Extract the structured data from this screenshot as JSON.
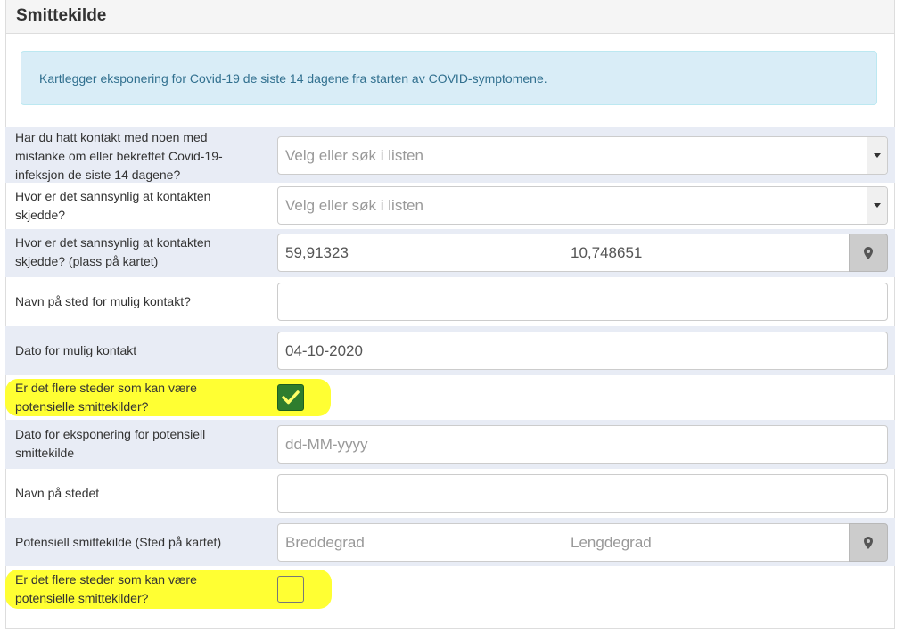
{
  "section": {
    "title": "Smittekilde",
    "info": "Kartlegger eksponering for Covid-19 de siste 14 dagene fra starten av COVID-symptomene."
  },
  "fields": {
    "contact_known": {
      "label_lines": [
        "Har du hatt kontakt med noen med",
        "mistanke om eller bekreftet Covid-19-",
        "infeksjon de siste 14 dagene?"
      ],
      "placeholder": "Velg eller søk i listen"
    },
    "contact_where": {
      "label_lines": [
        "Hvor er det sannsynlig at kontakten",
        "skjedde?"
      ],
      "placeholder": "Velg eller søk i listen"
    },
    "contact_map": {
      "label_lines": [
        "Hvor er det sannsynlig at kontakten",
        "skjedde? (plass på kartet)"
      ],
      "latitude": "59,91323",
      "longitude": "10,748651"
    },
    "place_name": {
      "label": "Navn på sted for mulig kontakt?",
      "value": ""
    },
    "contact_date": {
      "label": "Dato for mulig kontakt",
      "value": "04-10-2020"
    },
    "more_places_1": {
      "label_lines": [
        "Er det flere steder som kan være",
        "potensielle smittekilder?"
      ],
      "checked": true
    },
    "exposure_date": {
      "label_lines": [
        "Dato for eksponering for potensiell",
        "smittekilde"
      ],
      "placeholder": "dd-MM-yyyy"
    },
    "location_name": {
      "label": "Navn på stedet",
      "value": ""
    },
    "source_map": {
      "label": "Potensiell smittekilde (Sted på kartet)",
      "latitude_placeholder": "Breddegrad",
      "longitude_placeholder": "Lengdegrad"
    },
    "more_places_2": {
      "label_lines": [
        "Er det flere steder som kan være",
        "potensielle smittekilder?"
      ],
      "checked": false
    }
  },
  "colors": {
    "highlight": "#ffff33",
    "checkbox_checked": "#2e7d2e",
    "info_bg": "#d9edf7",
    "info_text": "#31708f",
    "row_shade": "#e8ecf5"
  },
  "icons": {
    "select_caret": "chevron-down-icon",
    "map_pin": "map-marker-icon",
    "checkmark": "checkmark-icon"
  }
}
